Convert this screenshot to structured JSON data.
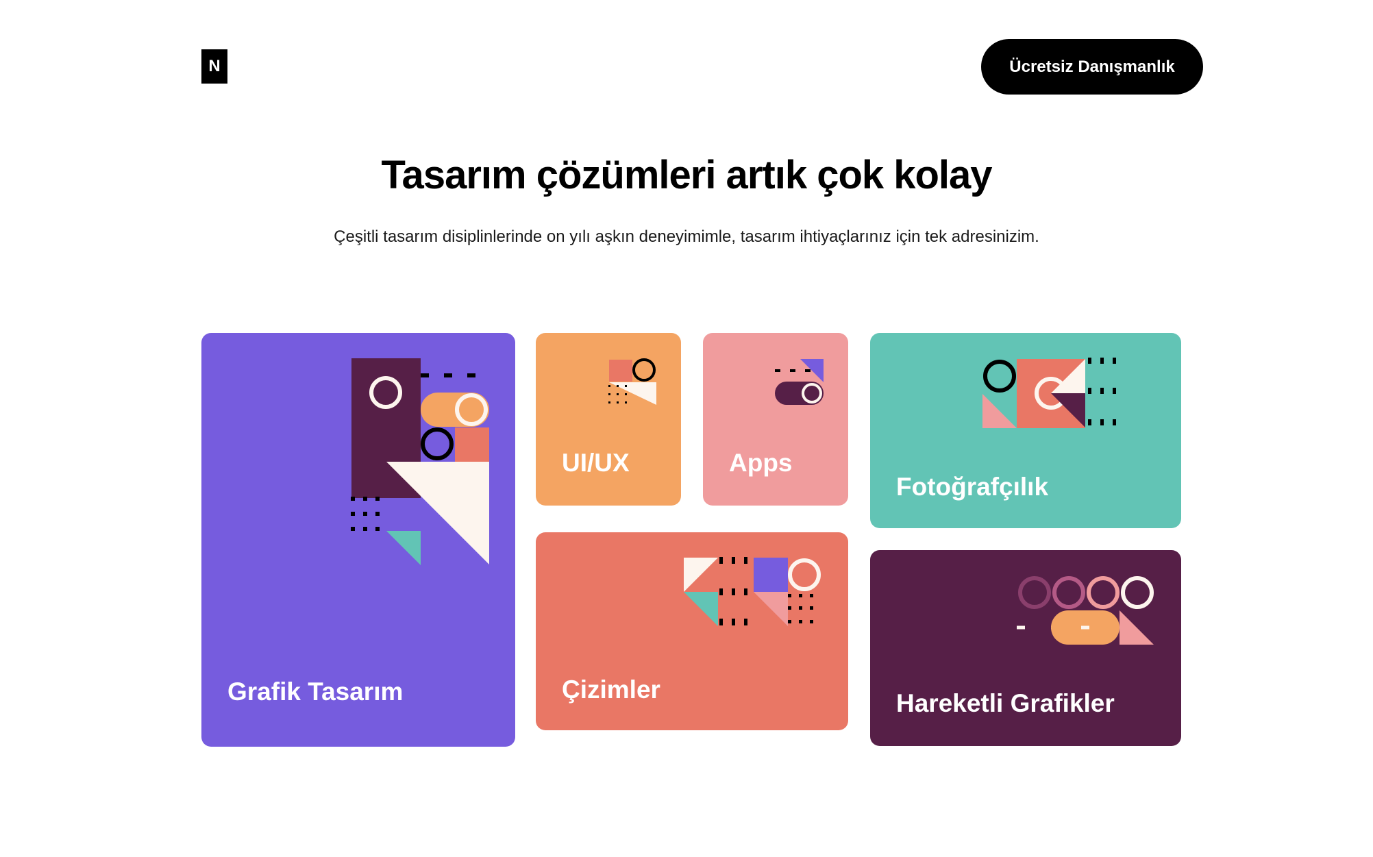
{
  "header": {
    "logo_letter": "N",
    "cta_label": "Ücretsiz Danışmanlık"
  },
  "hero": {
    "title": "Tasarım çözümleri artık çok kolay",
    "subtitle": "Çeşitli tasarım disiplinlerinde on yılı aşkın deneyimimle, tasarım ihtiyaçlarınız için tek adresinizim."
  },
  "services": [
    {
      "label": "Grafik Tasarım",
      "color": "#765cde"
    },
    {
      "label": "UI/UX",
      "color": "#f4a462"
    },
    {
      "label": "Apps",
      "color": "#f09c9d"
    },
    {
      "label": "Çizimler",
      "color": "#e97765"
    },
    {
      "label": "Fotoğrafçılık",
      "color": "#62c4b5"
    },
    {
      "label": "Hareketli Grafikler",
      "color": "#561f47"
    }
  ],
  "palette": {
    "purple": "#765cde",
    "orange": "#f4a462",
    "pink": "#f09c9d",
    "coral": "#e97765",
    "teal": "#62c4b5",
    "plum": "#561f47",
    "cream": "#fdf5ee"
  }
}
